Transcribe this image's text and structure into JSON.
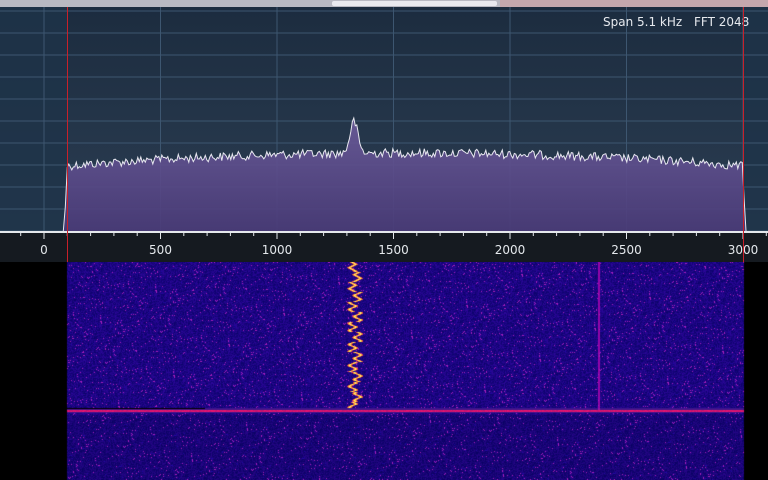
{
  "display": {
    "span_label": "Span 5.1 kHz",
    "fft_label": "FFT 2048"
  },
  "frequency_axis": {
    "min": -100,
    "max": 3100,
    "passband_low": 100,
    "passband_high": 3000,
    "major_ticks": [
      {
        "value": 0,
        "label": "0"
      },
      {
        "value": 500,
        "label": "500"
      },
      {
        "value": 1000,
        "label": "1000"
      },
      {
        "value": 1500,
        "label": "1500"
      },
      {
        "value": 2000,
        "label": "2000"
      },
      {
        "value": 2500,
        "label": "2500"
      },
      {
        "value": 3000,
        "label": "3000"
      }
    ],
    "minor_tick_step": 100
  },
  "signals": {
    "carrier_hz": 1330,
    "spectrum_color": "#6a5a9a",
    "trace_color": "#e8e8f0",
    "passband_color": "#c8202a"
  }
}
